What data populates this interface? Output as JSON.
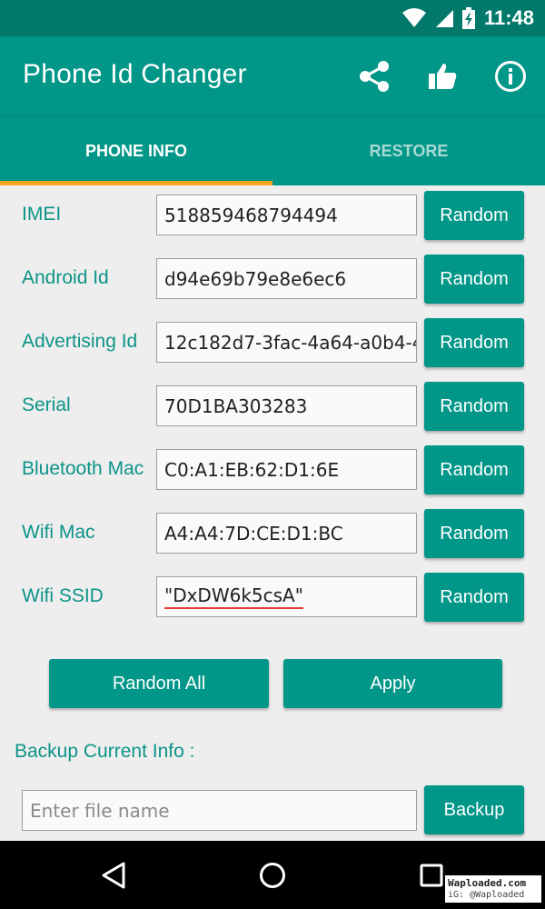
{
  "status_bar": {
    "time": "11:48",
    "icons": [
      "wifi-icon",
      "signal-icon",
      "battery-charging-icon"
    ]
  },
  "app_bar": {
    "title": "Phone Id Changer",
    "actions": [
      "share-icon",
      "thumbs-up-icon",
      "info-icon"
    ]
  },
  "tabs": [
    {
      "label": "PHONE INFO",
      "active": true
    },
    {
      "label": "RESTORE",
      "active": false
    }
  ],
  "fields": [
    {
      "label": "IMEI",
      "value": "518859468794494",
      "button": "Random"
    },
    {
      "label": "Android Id",
      "value": "d94e69b79e8e6ec6",
      "button": "Random"
    },
    {
      "label": "Advertising Id",
      "value": "12c182d7-3fac-4a64-a0b4-4",
      "button": "Random"
    },
    {
      "label": "Serial",
      "value": "70D1BA303283",
      "button": "Random"
    },
    {
      "label": "Bluetooth Mac",
      "value": "C0:A1:EB:62:D1:6E",
      "button": "Random"
    },
    {
      "label": "Wifi Mac",
      "value": "A4:A4:7D:CE:D1:BC",
      "button": "Random"
    },
    {
      "label": "Wifi SSID",
      "value": "\"DxDW6k5csA\"",
      "button": "Random"
    }
  ],
  "actions": {
    "random_all": "Random All",
    "apply": "Apply"
  },
  "backup": {
    "label": "Backup Current Info :",
    "placeholder": "Enter file name",
    "button": "Backup"
  },
  "nav_bar": [
    "back-icon",
    "home-icon",
    "recent-apps-icon"
  ],
  "watermark": {
    "line1": "Waploaded.com",
    "line2": "iG: @Waploaded"
  },
  "colors": {
    "primary": "#009688",
    "primary_dark": "#00796b",
    "accent": "#f5a623",
    "label_text": "#0d9488"
  }
}
